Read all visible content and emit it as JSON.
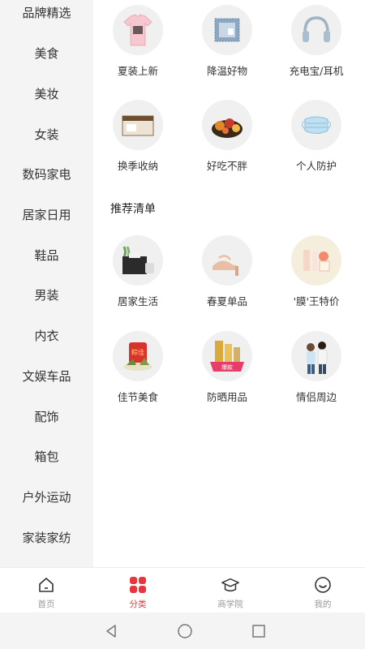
{
  "sidebar": {
    "items": [
      {
        "label": "品牌精选"
      },
      {
        "label": "美食"
      },
      {
        "label": "美妆"
      },
      {
        "label": "女装"
      },
      {
        "label": "数码家电"
      },
      {
        "label": "居家日用"
      },
      {
        "label": "鞋品"
      },
      {
        "label": "男装"
      },
      {
        "label": "内衣"
      },
      {
        "label": "文娱车品"
      },
      {
        "label": "配饰"
      },
      {
        "label": "箱包"
      },
      {
        "label": "户外运动"
      },
      {
        "label": "家装家纺"
      }
    ]
  },
  "main": {
    "top_items": [
      {
        "label": "夏装上新",
        "icon": "tshirt-icon"
      },
      {
        "label": "降温好物",
        "icon": "cooling-pad-icon"
      },
      {
        "label": "充电宝/耳机",
        "icon": "headphones-icon"
      },
      {
        "label": "换季收纳",
        "icon": "storage-box-icon"
      },
      {
        "label": "好吃不胖",
        "icon": "dried-fruit-icon"
      },
      {
        "label": "个人防护",
        "icon": "face-mask-icon"
      }
    ],
    "section_title": "推荐清单",
    "recommend_items": [
      {
        "label": "居家生活",
        "icon": "tissue-box-icon"
      },
      {
        "label": "春夏单品",
        "icon": "sandal-icon"
      },
      {
        "label": "'膜'王特价",
        "icon": "facial-mask-icon"
      },
      {
        "label": "佳节美食",
        "icon": "zongzi-icon",
        "badge": "粽佳"
      },
      {
        "label": "防晒用品",
        "icon": "sunscreen-icon",
        "badge": "爆款"
      },
      {
        "label": "情侣周边",
        "icon": "couple-icon"
      }
    ]
  },
  "tabbar": {
    "tabs": [
      {
        "label": "首页",
        "icon": "home-icon"
      },
      {
        "label": "分类",
        "icon": "category-icon",
        "active": true
      },
      {
        "label": "商学院",
        "icon": "graduation-cap-icon"
      },
      {
        "label": "我的",
        "icon": "smiley-icon"
      }
    ],
    "active_color": "#e9353b",
    "inactive_color": "#999999"
  },
  "system_nav": {
    "icons": [
      "back-icon",
      "home-circle-icon",
      "recents-icon"
    ]
  }
}
